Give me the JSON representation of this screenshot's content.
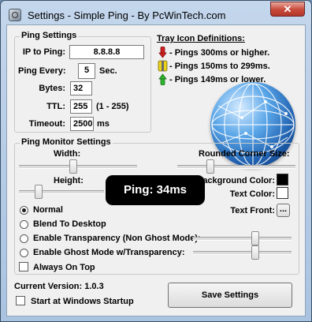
{
  "window": {
    "title": "Settings - Simple Ping - By PcWinTech.com",
    "close_glyph": "✕"
  },
  "ping_settings": {
    "legend": "Ping Settings",
    "ip_label": "IP to Ping:",
    "ip_value": "8.8.8.8",
    "every_label": "Ping Every:",
    "every_value": "5",
    "every_unit": "Sec.",
    "bytes_label": "Bytes:",
    "bytes_value": "32",
    "ttl_label": "TTL:",
    "ttl_value": "255",
    "ttl_range": "(1 - 255)",
    "timeout_label": "Timeout:",
    "timeout_value": "2500",
    "timeout_unit": "ms"
  },
  "tray": {
    "title": "Tray Icon Definitions:",
    "items": [
      {
        "label": "- Pings 300ms or higher.",
        "color": "#d11f1f"
      },
      {
        "label": "- Pings 150ms to 299ms.",
        "color": "#e8d21b"
      },
      {
        "label": "- Pings 149ms or lower.",
        "color": "#2fb52f"
      }
    ]
  },
  "monitor": {
    "legend": "Ping Monitor Settings",
    "width_label": "Width:",
    "height_label": "Height:",
    "rounded_label": "Rounded Corner Size:",
    "bg_color_label": "Background Color:",
    "bg_color": "#000000",
    "text_color_label": "Text Color:",
    "text_color": "#ffffff",
    "text_font_label": "Text Front:",
    "font_button": "...",
    "preview_text": "Ping: 34ms",
    "modes": {
      "normal": "Normal",
      "blend": "Blend To Desktop",
      "transparency": "Enable Transparency (Non Ghost Mode):",
      "ghost": "Enable Ghost Mode w/Transparency:"
    },
    "selected_mode": "normal",
    "always_on_top": "Always On Top"
  },
  "footer": {
    "version": "Current Version: 1.0.3",
    "startup": "Start at Windows Startup",
    "save": "Save Settings"
  }
}
